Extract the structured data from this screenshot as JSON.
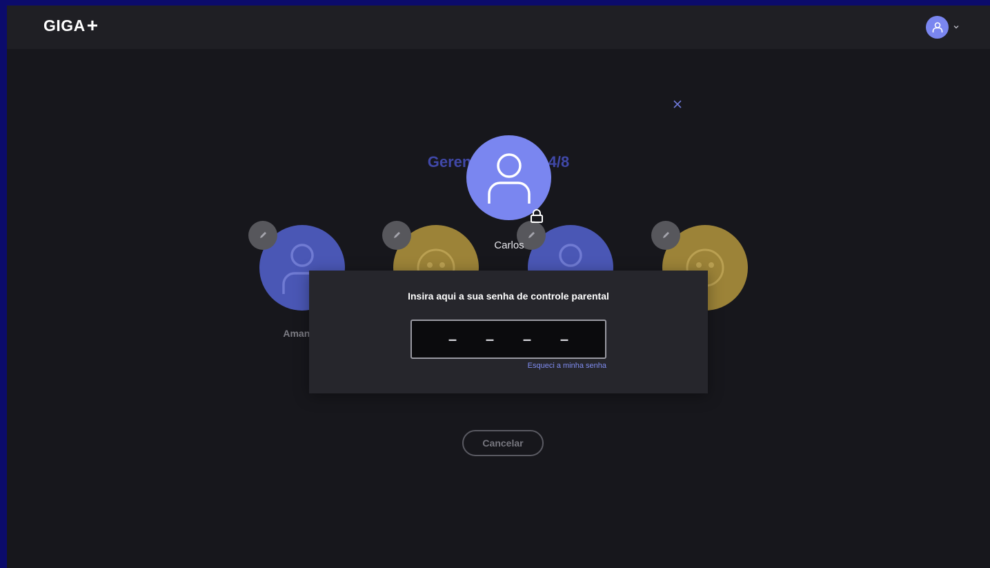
{
  "header": {
    "logo_text": "GIGA",
    "logo_suffix": "+",
    "account_icon": "user-icon",
    "chevron_icon": "chevron-down-icon"
  },
  "background": {
    "title": "Gerenciar perfis 4/8",
    "close_icon": "close-icon",
    "profiles": [
      {
        "name": "Amanda",
        "color": "blue",
        "sub": ""
      },
      {
        "name": "",
        "color": "gold",
        "sub": ""
      },
      {
        "name": "",
        "color": "blue",
        "sub": ""
      },
      {
        "name": "",
        "color": "gold",
        "sub": ""
      }
    ],
    "cancel_label": "Cancelar"
  },
  "selected_profile": {
    "name": "Carlos",
    "lock_icon": "lock-icon"
  },
  "modal": {
    "title": "Insira aqui a sua senha de controle parental",
    "pin_placeholders": [
      "–",
      "–",
      "–",
      "–"
    ],
    "forgot_label": "Esqueci a minha senha"
  },
  "colors": {
    "accent": "#7a86f0",
    "gold": "#9c8338",
    "background": "#17171c"
  }
}
